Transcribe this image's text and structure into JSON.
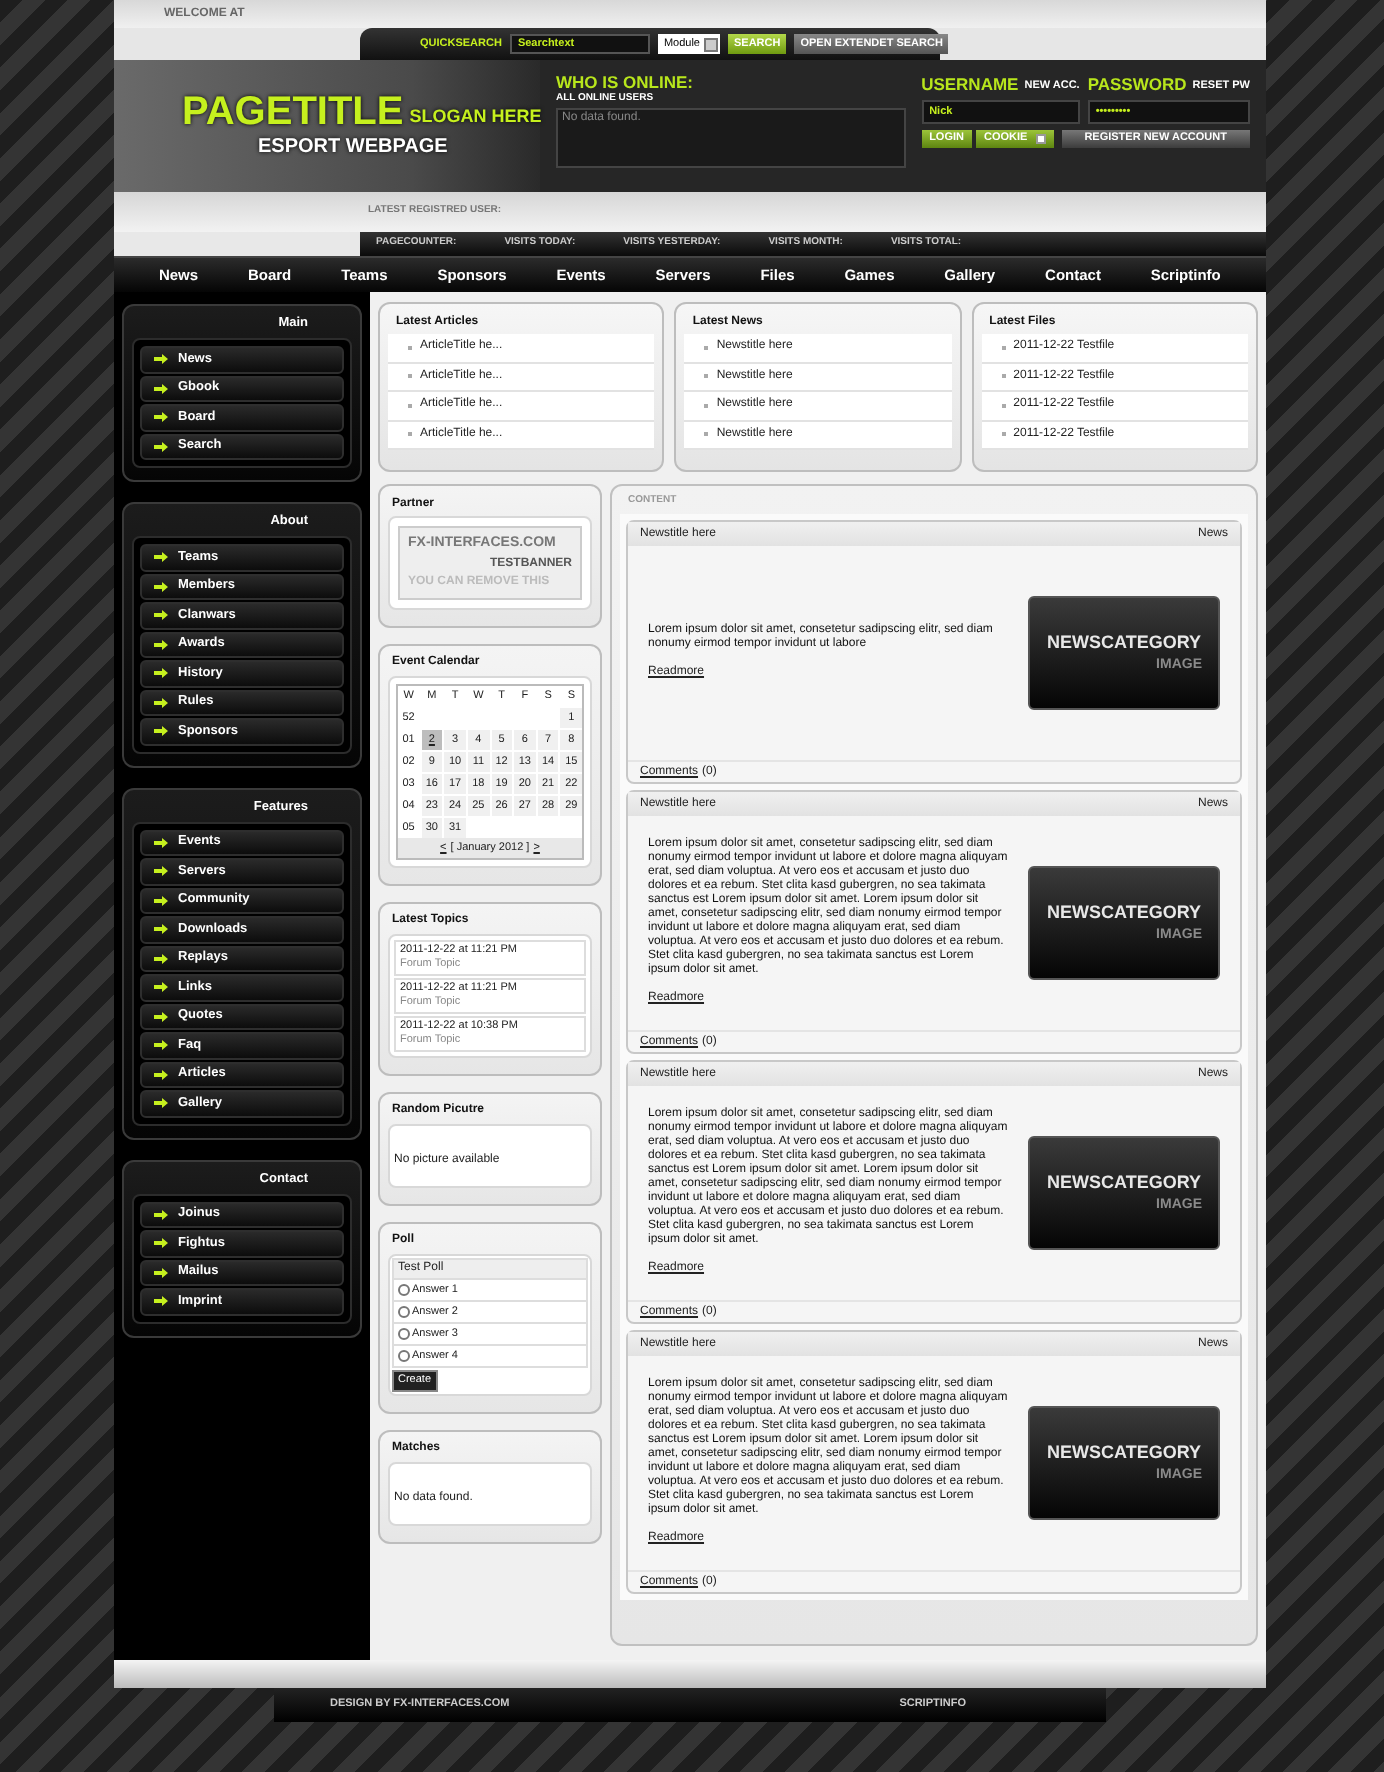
{
  "header": {
    "welcome": "WELCOME AT",
    "quicksearch": {
      "label": "QUICKSEARCH",
      "value": "Searchtext",
      "module": "Module",
      "search_button": "SEARCH",
      "extended_button": "OPEN EXTENDET SEARCH"
    },
    "title": "PAGETITLE",
    "slogan": "SLOGAN HERE",
    "subtitle": "ESPORT WEBPAGE",
    "online": {
      "title": "WHO IS ONLINE:",
      "subtitle": "ALL ONLINE USERS",
      "text": "No data found."
    },
    "login": {
      "username_label": "USERNAME",
      "new_account": "NEW ACC.",
      "password_label": "PASSWORD",
      "reset": "RESET PW",
      "username": "Nick",
      "password": "•••••••••",
      "login_button": "LOGIN",
      "cookie_label": "COOKIE",
      "cookie_checked": false,
      "register_button": "REGISTER NEW ACCOUNT"
    },
    "latest_user": "LATEST REGISTRED USER:",
    "stats": [
      "PAGECOUNTER:",
      "VISITS TODAY:",
      "VISITS YESTERDAY:",
      "VISITS MONTH:",
      "VISITS TOTAL:"
    ]
  },
  "nav": [
    "News",
    "Board",
    "Teams",
    "Sponsors",
    "Events",
    "Servers",
    "Files",
    "Games",
    "Gallery",
    "Contact",
    "Scriptinfo"
  ],
  "sidebar": [
    {
      "title": "Main",
      "items": [
        "News",
        "Gbook",
        "Board",
        "Search"
      ]
    },
    {
      "title": "About",
      "items": [
        "Teams",
        "Members",
        "Clanwars",
        "Awards",
        "History",
        "Rules",
        "Sponsors"
      ]
    },
    {
      "title": "Features",
      "items": [
        "Events",
        "Servers",
        "Community",
        "Downloads",
        "Replays",
        "Links",
        "Quotes",
        "Faq",
        "Articles",
        "Gallery"
      ]
    },
    {
      "title": "Contact",
      "items": [
        "Joinus",
        "Fightus",
        "Mailus",
        "Imprint"
      ]
    }
  ],
  "top_boxes": [
    {
      "title": "Latest Articles",
      "items": [
        "ArticleTitle he...",
        "ArticleTitle he...",
        "ArticleTitle he...",
        "ArticleTitle he..."
      ]
    },
    {
      "title": "Latest News",
      "items": [
        "Newstitle here",
        "Newstitle here",
        "Newstitle here",
        "Newstitle here"
      ]
    },
    {
      "title": "Latest Files",
      "items": [
        "2011-12-22 Testfile",
        "2011-12-22 Testfile",
        "2011-12-22 Testfile",
        "2011-12-22 Testfile"
      ]
    }
  ],
  "partner": {
    "title": "Partner",
    "banner": [
      "FX-INTERFACES.COM",
      "TESTBANNER",
      "YOU CAN REMOVE THIS"
    ]
  },
  "calendar": {
    "title": "Event Calendar",
    "headers": [
      "W",
      "M",
      "T",
      "W",
      "T",
      "F",
      "S",
      "S"
    ],
    "weeks": [
      {
        "week": "52",
        "kind": "leading",
        "days": [
          {
            "day": "1",
            "selected": false
          }
        ]
      },
      {
        "week": "01",
        "kind": "full",
        "days": [
          {
            "day": "2",
            "selected": true
          },
          {
            "day": "3",
            "selected": false
          },
          {
            "day": "4",
            "selected": false
          },
          {
            "day": "5",
            "selected": false
          },
          {
            "day": "6",
            "selected": false
          },
          {
            "day": "7",
            "selected": false
          },
          {
            "day": "8",
            "selected": false
          }
        ]
      },
      {
        "week": "02",
        "kind": "full",
        "days": [
          {
            "day": "9",
            "selected": false
          },
          {
            "day": "10",
            "selected": false
          },
          {
            "day": "11",
            "selected": false
          },
          {
            "day": "12",
            "selected": false
          },
          {
            "day": "13",
            "selected": false
          },
          {
            "day": "14",
            "selected": false
          },
          {
            "day": "15",
            "selected": false
          }
        ]
      },
      {
        "week": "03",
        "kind": "full",
        "days": [
          {
            "day": "16",
            "selected": false
          },
          {
            "day": "17",
            "selected": false
          },
          {
            "day": "18",
            "selected": false
          },
          {
            "day": "19",
            "selected": false
          },
          {
            "day": "20",
            "selected": false
          },
          {
            "day": "21",
            "selected": false
          },
          {
            "day": "22",
            "selected": false
          }
        ]
      },
      {
        "week": "04",
        "kind": "full",
        "days": [
          {
            "day": "23",
            "selected": false
          },
          {
            "day": "24",
            "selected": false
          },
          {
            "day": "25",
            "selected": false
          },
          {
            "day": "26",
            "selected": false
          },
          {
            "day": "27",
            "selected": false
          },
          {
            "day": "28",
            "selected": false
          },
          {
            "day": "29",
            "selected": false
          }
        ]
      },
      {
        "week": "05",
        "kind": "trailing",
        "days": [
          {
            "day": "30",
            "selected": false
          },
          {
            "day": "31",
            "selected": false
          }
        ]
      }
    ],
    "prev": "<",
    "month": "[ January 2012 ]",
    "next": ">"
  },
  "topics": {
    "title": "Latest Topics",
    "items": [
      {
        "date": "2011-12-22 at 11:21 PM",
        "forum": "Forum Topic"
      },
      {
        "date": "2011-12-22 at 11:21 PM",
        "forum": "Forum Topic"
      },
      {
        "date": "2011-12-22 at 10:38 PM",
        "forum": "Forum Topic"
      }
    ]
  },
  "random_picture": {
    "title": "Random Picutre",
    "text": "No picture available"
  },
  "poll": {
    "title": "Poll",
    "question": "Test Poll",
    "answers": [
      {
        "label": "Answer 1",
        "selected": false
      },
      {
        "label": "Answer 2",
        "selected": false
      },
      {
        "label": "Answer 3",
        "selected": false
      },
      {
        "label": "Answer 4",
        "selected": false
      }
    ],
    "button": "Create"
  },
  "matches": {
    "title": "Matches",
    "text": "No data found."
  },
  "content": {
    "label": "CONTENT",
    "news": [
      {
        "title": "Newstitle here",
        "category": "News",
        "text": "Lorem ipsum dolor sit amet, consetetur sadipscing elitr, sed diam nonumy eirmod tempor invidunt ut labore",
        "readmore": "Readmore",
        "comments_link": "Comments",
        "comments_count": "(0)",
        "image_title": "NEWSCATEGORY",
        "image_subtitle": "IMAGE"
      },
      {
        "title": "Newstitle here",
        "category": "News",
        "text": "Lorem ipsum dolor sit amet, consetetur sadipscing elitr, sed diam nonumy eirmod tempor invidunt ut labore et dolore magna aliquyam erat, sed diam voluptua. At vero eos et accusam et justo duo dolores et ea rebum. Stet clita kasd gubergren, no sea takimata sanctus est Lorem ipsum dolor sit amet. Lorem ipsum dolor sit amet, consetetur sadipscing elitr, sed diam nonumy eirmod tempor invidunt ut labore et dolore magna aliquyam erat, sed diam voluptua. At vero eos et accusam et justo duo dolores et ea rebum. Stet clita kasd gubergren, no sea takimata sanctus est Lorem ipsum dolor sit amet.",
        "readmore": "Readmore",
        "comments_link": "Comments",
        "comments_count": "(0)",
        "image_title": "NEWSCATEGORY",
        "image_subtitle": "IMAGE"
      },
      {
        "title": "Newstitle here",
        "category": "News",
        "text": "Lorem ipsum dolor sit amet, consetetur sadipscing elitr, sed diam nonumy eirmod tempor invidunt ut labore et dolore magna aliquyam erat, sed diam voluptua. At vero eos et accusam et justo duo dolores et ea rebum. Stet clita kasd gubergren, no sea takimata sanctus est Lorem ipsum dolor sit amet. Lorem ipsum dolor sit amet, consetetur sadipscing elitr, sed diam nonumy eirmod tempor invidunt ut labore et dolore magna aliquyam erat, sed diam voluptua. At vero eos et accusam et justo duo dolores et ea rebum. Stet clita kasd gubergren, no sea takimata sanctus est Lorem ipsum dolor sit amet.",
        "readmore": "Readmore",
        "comments_link": "Comments",
        "comments_count": "(0)",
        "image_title": "NEWSCATEGORY",
        "image_subtitle": "IMAGE"
      },
      {
        "title": "Newstitle here",
        "category": "News",
        "text": "Lorem ipsum dolor sit amet, consetetur sadipscing elitr, sed diam nonumy eirmod tempor invidunt ut labore et dolore magna aliquyam erat, sed diam voluptua. At vero eos et accusam et justo duo dolores et ea rebum. Stet clita kasd gubergren, no sea takimata sanctus est Lorem ipsum dolor sit amet. Lorem ipsum dolor sit amet, consetetur sadipscing elitr, sed diam nonumy eirmod tempor invidunt ut labore et dolore magna aliquyam erat, sed diam voluptua. At vero eos et accusam et justo duo dolores et ea rebum. Stet clita kasd gubergren, no sea takimata sanctus est Lorem ipsum dolor sit amet.",
        "readmore": "Readmore",
        "comments_link": "Comments",
        "comments_count": "(0)",
        "image_title": "NEWSCATEGORY",
        "image_subtitle": "IMAGE"
      }
    ]
  },
  "footer": {
    "credit": "DESIGN BY FX-INTERFACES.COM",
    "scriptinfo": "SCRIPTINFO"
  }
}
